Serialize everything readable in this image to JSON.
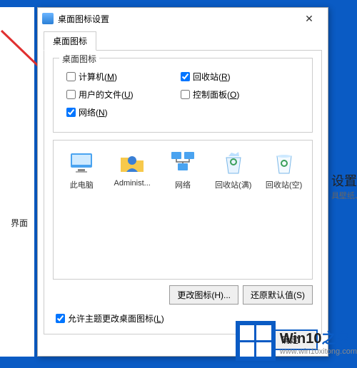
{
  "dialog": {
    "title": "桌面图标设置",
    "tab": "桌面图标",
    "group_legend": "桌面图标",
    "checkboxes": {
      "computer": {
        "label": "计算机(",
        "key": "M",
        "tail": ")",
        "checked": false
      },
      "recycle": {
        "label": "回收站(",
        "key": "R",
        "tail": ")",
        "checked": true
      },
      "userdocs": {
        "label": "用户的文件(",
        "key": "U",
        "tail": ")",
        "checked": false
      },
      "cpanel": {
        "label": "控制面板(",
        "key": "O",
        "tail": ")",
        "checked": false
      },
      "network": {
        "label": "网络(",
        "key": "N",
        "tail": ")",
        "checked": true
      }
    },
    "icons": [
      {
        "name": "此电脑"
      },
      {
        "name": "Administ..."
      },
      {
        "name": "网络"
      },
      {
        "name": "回收站(满)"
      },
      {
        "name": "回收站(空)"
      }
    ],
    "change_icon": "更改图标(H)...",
    "restore_default": "还原默认值(S)",
    "allow_theme": {
      "label": "允许主题更改桌面图标(",
      "key": "L",
      "tail": ")",
      "checked": true
    },
    "ok": "确定"
  },
  "background": {
    "left_label": "界面",
    "right_heading": "设置",
    "right_sub": "具壁纸、声音"
  },
  "watermark": {
    "line1a": "Win10",
    "line1b": "之家",
    "line2": "www.win10xitong.com"
  }
}
